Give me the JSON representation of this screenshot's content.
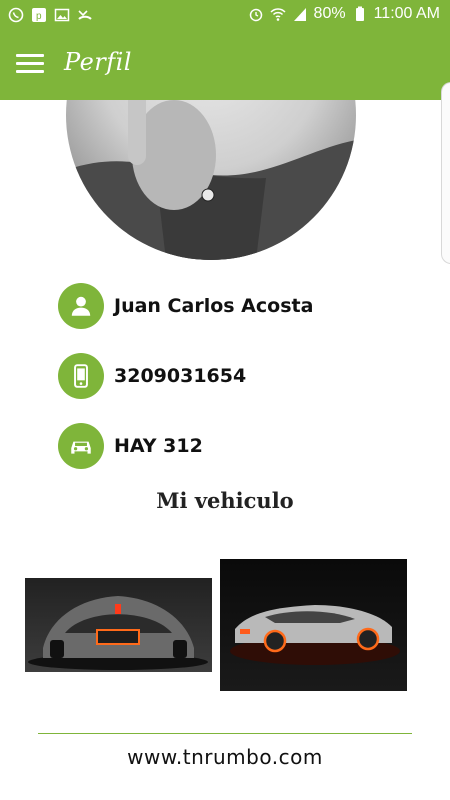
{
  "status_bar": {
    "battery": "80%",
    "time": "11:00 AM",
    "icons": [
      "whatsapp-icon",
      "p-app-icon",
      "image-icon",
      "missed-call-icon",
      "alarm-icon",
      "wifi-icon",
      "signal-icon",
      "battery-icon"
    ]
  },
  "header": {
    "title": "Perfil",
    "menu_icon": "hamburger-menu-icon"
  },
  "profile": {
    "name": "Juan Carlos Acosta",
    "phone": "3209031654",
    "plate": "HAY 312",
    "icons": {
      "name": "person-icon",
      "phone": "phone-icon",
      "plate": "car-icon"
    }
  },
  "vehicle_section": {
    "title": "Mi vehiculo"
  },
  "footer": {
    "url": "www.tnrumbo.com"
  },
  "colors": {
    "accent": "#7fb53a",
    "text": "#111111"
  }
}
